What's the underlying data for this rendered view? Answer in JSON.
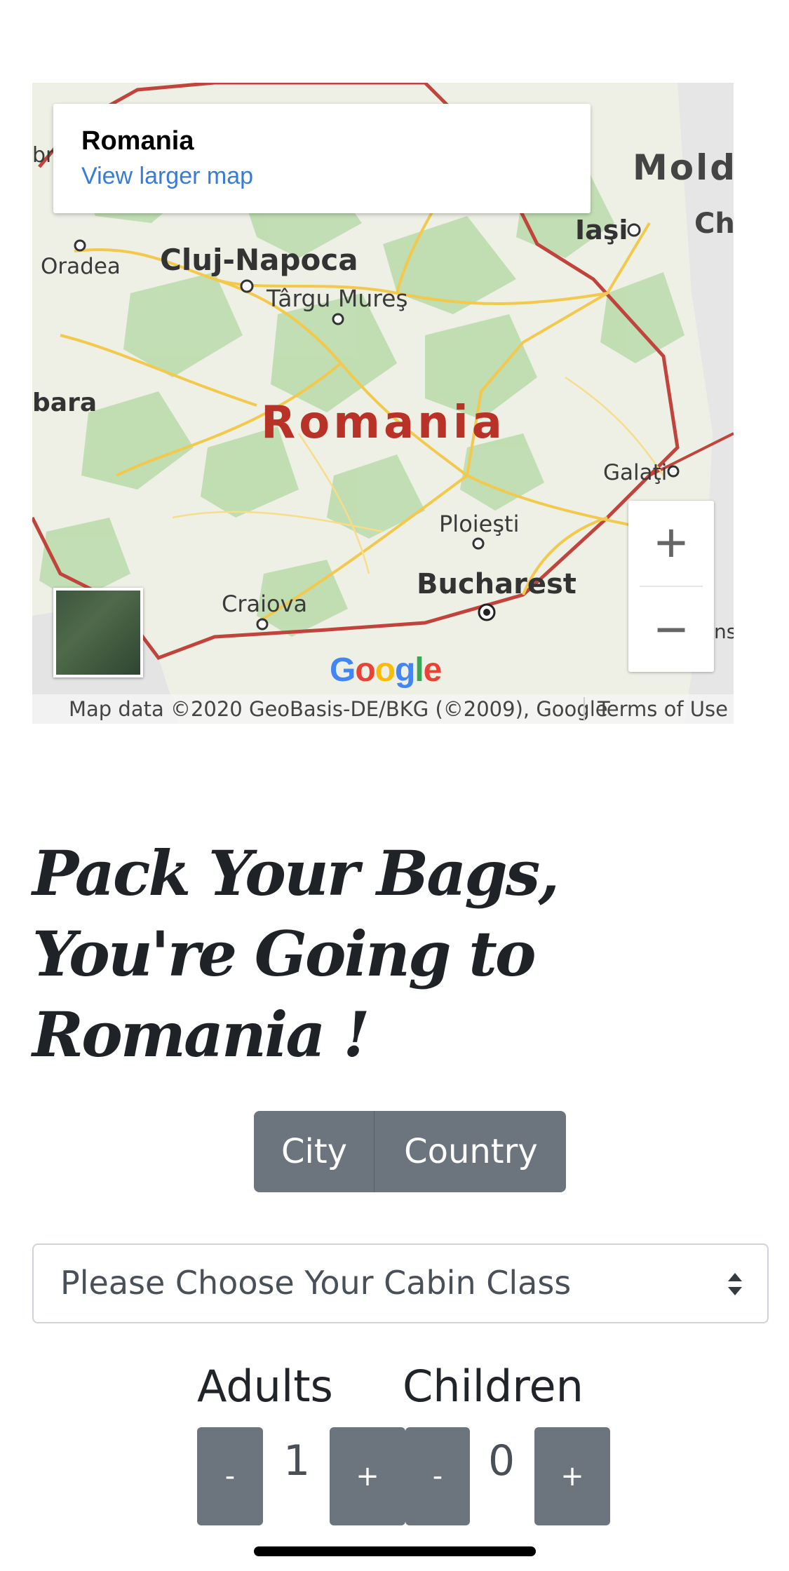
{
  "map": {
    "info_title": "Romania",
    "info_link": "View larger map",
    "country_label": "Romania",
    "cities": {
      "oradea": "Oradea",
      "cluj": "Cluj-Napoca",
      "targu": "Târgu Mureş",
      "iasi": "Iaşi",
      "mold": "Mold",
      "ch": "Ch",
      "bara": "bara",
      "br": "br",
      "galati": "Galaţi",
      "ploiesti": "Ploieşti",
      "bucharest": "Bucharest",
      "craiova": "Craiova",
      "ns": "ns"
    },
    "zoom_in": "+",
    "zoom_out": "−",
    "google": "Google",
    "attribution": "Map data ©2020 GeoBasis-DE/BKG (©2009), Google",
    "terms": "Terms of Use",
    "colors": {
      "border": "#c1443c",
      "roads": "#f2c94c",
      "green": "#b9dbaa",
      "water": "#aad3df"
    }
  },
  "heading": {
    "line1": "Pack Your Bags,",
    "line2": "You're Going to",
    "line3": "Romania !"
  },
  "toggle": {
    "city": "City",
    "country": "Country"
  },
  "cabin": {
    "placeholder": "Please Choose Your Cabin Class"
  },
  "passengers": {
    "adults_label": "Adults",
    "children_label": "Children",
    "adults_value": "1",
    "children_value": "0",
    "minus": "-",
    "plus": "+"
  },
  "colors": {
    "button_bg": "#6c757d",
    "heading": "#1f2226",
    "link": "#3a7bd5"
  }
}
